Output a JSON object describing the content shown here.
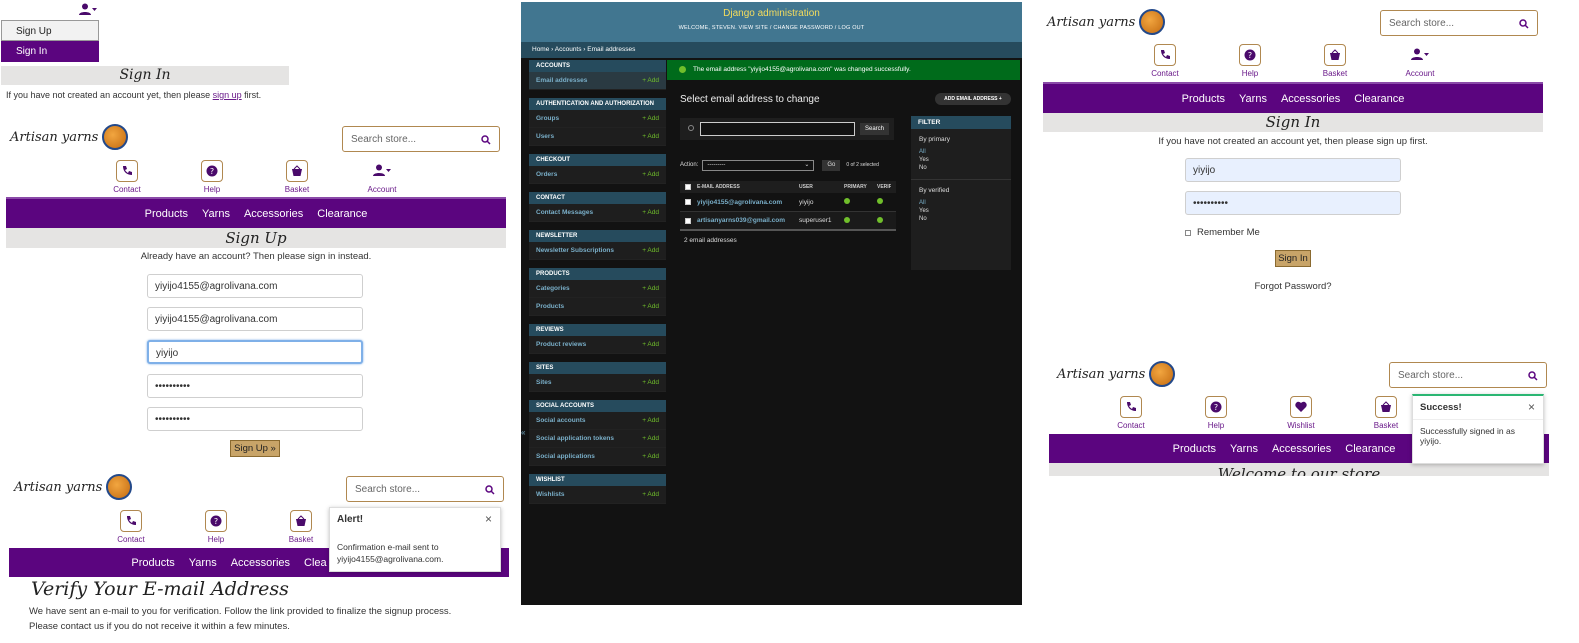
{
  "panel1": {
    "dropdown": {
      "sign_up": "Sign Up",
      "sign_in": "Sign In"
    },
    "signin_title": "Sign In",
    "signin_text_pre": "If you have not created an account yet, then please ",
    "signin_text_link": "sign up",
    "signin_text_post": " first.",
    "search_placeholder": "Search store...",
    "nav_icons": [
      {
        "label": "Contact"
      },
      {
        "label": "Help"
      },
      {
        "label": "Basket"
      },
      {
        "label": "Account"
      }
    ],
    "nav": [
      "Products",
      "Yarns",
      "Accessories",
      "Clearance"
    ],
    "signup_title": "Sign Up",
    "signup_sub": "Already have an account? Then please sign in instead.",
    "fields": [
      "yiyijo4155@agrolivana.com",
      "yiyijo4155@agrolivana.com",
      "yiyijo",
      "••••••••••",
      "••••••••••"
    ],
    "signup_button": "Sign Up »"
  },
  "panel2": {
    "search_placeholder": "Search store...",
    "nav_icons": [
      {
        "label": "Contact"
      },
      {
        "label": "Help"
      },
      {
        "label": "Basket"
      }
    ],
    "nav": [
      "Products",
      "Yarns",
      "Accessories",
      "Clea"
    ],
    "toast_title": "Alert!",
    "toast_body": "Confirmation e-mail sent to yiyijo4155@agrolivana.com.",
    "verify_title": "Verify Your E-mail Address",
    "verify_line1": "We have sent an e-mail to you for verification. Follow the link provided to finalize the signup process.",
    "verify_line2": "Please contact us if you do not receive it within a few minutes."
  },
  "admin": {
    "title": "Django administration",
    "user_bar": "WELCOME, STEVEN. VIEW SITE / CHANGE PASSWORD / LOG OUT",
    "breadcrumb": "Home › Accounts › Email addresses",
    "message": "The email address \"yiyijo4155@agrolivana.com\" was changed successfully.",
    "heading": "Select email address to change",
    "add_button": "ADD EMAIL ADDRESS +",
    "search_button": "Search",
    "action_label": "Action:",
    "action_select": "---------",
    "go_button": "Go",
    "selected_count": "0 of 2 selected",
    "columns": [
      "E-MAIL ADDRESS",
      "USER",
      "PRIMARY",
      "VERIF"
    ],
    "rows": [
      {
        "email": "yiyijo4155@agrolivana.com",
        "user": "yiyijo"
      },
      {
        "email": "artisanyarns039@gmail.com",
        "user": "superuser1"
      }
    ],
    "count_text": "2 email addresses",
    "filter": {
      "title": "FILTER",
      "by_primary": "By primary",
      "by_verified": "By verified",
      "options": [
        "All",
        "Yes",
        "No"
      ]
    },
    "add_label": "+ Add",
    "sections": [
      {
        "title": "ACCOUNTS",
        "items": [
          "Email addresses"
        ]
      },
      {
        "title": "AUTHENTICATION AND AUTHORIZATION",
        "items": [
          "Groups",
          "Users"
        ]
      },
      {
        "title": "CHECKOUT",
        "items": [
          "Orders"
        ]
      },
      {
        "title": "CONTACT",
        "items": [
          "Contact Messages"
        ]
      },
      {
        "title": "NEWSLETTER",
        "items": [
          "Newsletter Subscriptions"
        ]
      },
      {
        "title": "PRODUCTS",
        "items": [
          "Categories",
          "Products"
        ]
      },
      {
        "title": "REVIEWS",
        "items": [
          "Product reviews"
        ]
      },
      {
        "title": "SITES",
        "items": [
          "Sites"
        ]
      },
      {
        "title": "SOCIAL ACCOUNTS",
        "items": [
          "Social accounts",
          "Social application tokens",
          "Social applications"
        ]
      },
      {
        "title": "WISHLIST",
        "items": [
          "Wishlists"
        ]
      }
    ]
  },
  "panel3": {
    "search_placeholder": "Search store...",
    "nav_icons": [
      {
        "label": "Contact"
      },
      {
        "label": "Help"
      },
      {
        "label": "Basket"
      },
      {
        "label": "Account"
      }
    ],
    "nav": [
      "Products",
      "Yarns",
      "Accessories",
      "Clearance"
    ],
    "title": "Sign In",
    "text": "If you have not created an account yet, then please sign up first.",
    "username": "yiyijo",
    "password": "••••••••••",
    "remember": "Remember Me",
    "button": "Sign In",
    "forgot": "Forgot Password?"
  },
  "panel4": {
    "search_placeholder": "Search store...",
    "nav_icons": [
      {
        "label": "Contact"
      },
      {
        "label": "Help"
      },
      {
        "label": "Wishlist"
      },
      {
        "label": "Basket"
      }
    ],
    "nav": [
      "Products",
      "Yarns",
      "Accessories",
      "Clearance"
    ],
    "toast_title": "Success!",
    "toast_body": "Successfully signed in as yiyijo.",
    "welcome": "Welcome to our store"
  },
  "logo_text": "Artisan yarns",
  "colors": {
    "brand_purple": "#5b057f",
    "admin_header": "#417690",
    "admin_success": "#006b1b",
    "link_blue": "#79aec8",
    "add_green": "#70bf2b"
  }
}
